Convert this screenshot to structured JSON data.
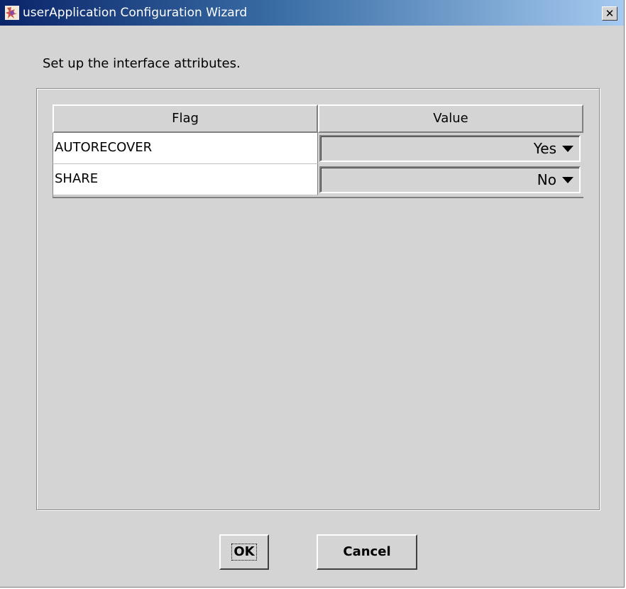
{
  "window": {
    "title": "userApplication Configuration Wizard",
    "close_glyph": "✕"
  },
  "instruction": "Set up the interface attributes.",
  "table": {
    "columns": [
      "Flag",
      "Value"
    ],
    "rows": [
      {
        "flag": "AUTORECOVER",
        "value": "Yes"
      },
      {
        "flag": "SHARE",
        "value": "No"
      }
    ]
  },
  "buttons": {
    "ok": "OK",
    "cancel": "Cancel"
  },
  "colors": {
    "window_bg": "#d4d4d4",
    "title_gradient_start": "#0a246a",
    "title_gradient_end": "#a6caf0"
  },
  "icons": {
    "app": "app-icon",
    "close": "close-icon",
    "dropdown": "dropdown-arrow-icon"
  }
}
